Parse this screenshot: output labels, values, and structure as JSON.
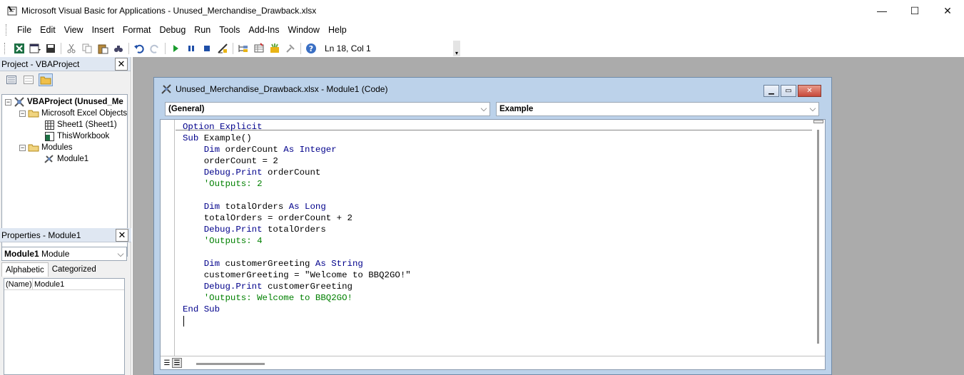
{
  "window": {
    "title": "Microsoft Visual Basic for Applications - Unused_Merchandise_Drawback.xlsx",
    "minimize": "—",
    "maximize": "☐",
    "close": "✕"
  },
  "menu": [
    "File",
    "Edit",
    "View",
    "Insert",
    "Format",
    "Debug",
    "Run",
    "Tools",
    "Add-Ins",
    "Window",
    "Help"
  ],
  "toolbar": {
    "status": "Ln 18, Col 1",
    "icons": [
      "excel-icon",
      "insert-module-icon",
      "save-icon",
      "cut-icon",
      "copy-icon",
      "paste-icon",
      "find-icon",
      "undo-icon",
      "redo-icon",
      "run-icon",
      "break-icon",
      "reset-icon",
      "design-mode-icon",
      "project-explorer-icon",
      "properties-icon",
      "object-browser-icon",
      "toolbox-icon",
      "help-icon"
    ]
  },
  "project": {
    "header": "Project - VBAProject",
    "tree": {
      "root": "VBAProject (Unused_Me",
      "excel_objects": "Microsoft Excel Objects",
      "sheet1": "Sheet1 (Sheet1)",
      "thisworkbook": "ThisWorkbook",
      "modules": "Modules",
      "module1": "Module1"
    }
  },
  "properties": {
    "header": "Properties - Module1",
    "object_name": "Module1",
    "object_type": "Module",
    "tab_alphabetic": "Alphabetic",
    "tab_categorized": "Categorized",
    "row_key": "(Name)",
    "row_value": "Module1"
  },
  "code_window": {
    "title": "Unused_Merchandise_Drawback.xlsx - Module1 (Code)",
    "object_combo": "(General)",
    "procedure_combo": "Example",
    "lines": [
      [
        {
          "t": "Option Explicit",
          "c": "kw"
        }
      ],
      [
        {
          "t": "Sub ",
          "c": "kw"
        },
        {
          "t": "Example()",
          "c": ""
        }
      ],
      [
        {
          "t": "    Dim ",
          "c": "kw"
        },
        {
          "t": "orderCount ",
          "c": ""
        },
        {
          "t": "As Integer",
          "c": "kw"
        }
      ],
      [
        {
          "t": "    orderCount = 2",
          "c": ""
        }
      ],
      [
        {
          "t": "    Debug.Print ",
          "c": "kw"
        },
        {
          "t": "orderCount",
          "c": ""
        }
      ],
      [
        {
          "t": "    'Outputs: 2",
          "c": "cm"
        }
      ],
      [
        {
          "t": "",
          "c": ""
        }
      ],
      [
        {
          "t": "    Dim ",
          "c": "kw"
        },
        {
          "t": "totalOrders ",
          "c": ""
        },
        {
          "t": "As Long",
          "c": "kw"
        }
      ],
      [
        {
          "t": "    totalOrders = orderCount + 2",
          "c": ""
        }
      ],
      [
        {
          "t": "    Debug.Print ",
          "c": "kw"
        },
        {
          "t": "totalOrders",
          "c": ""
        }
      ],
      [
        {
          "t": "    'Outputs: 4",
          "c": "cm"
        }
      ],
      [
        {
          "t": "",
          "c": ""
        }
      ],
      [
        {
          "t": "    Dim ",
          "c": "kw"
        },
        {
          "t": "customerGreeting ",
          "c": ""
        },
        {
          "t": "As String",
          "c": "kw"
        }
      ],
      [
        {
          "t": "    customerGreeting = \"Welcome to BBQ2GO!\"",
          "c": ""
        }
      ],
      [
        {
          "t": "    Debug.Print ",
          "c": "kw"
        },
        {
          "t": "customerGreeting",
          "c": ""
        }
      ],
      [
        {
          "t": "    'Outputs: Welcome to BBQ2GO!",
          "c": "cm"
        }
      ],
      [
        {
          "t": "End Sub",
          "c": "kw"
        }
      ],
      [
        {
          "t": "",
          "c": ""
        }
      ]
    ]
  },
  "colors": {
    "keyword": "#00008b",
    "comment": "#008000",
    "mdi_background": "#ababab",
    "code_window_frame": "#bcd2ea"
  }
}
